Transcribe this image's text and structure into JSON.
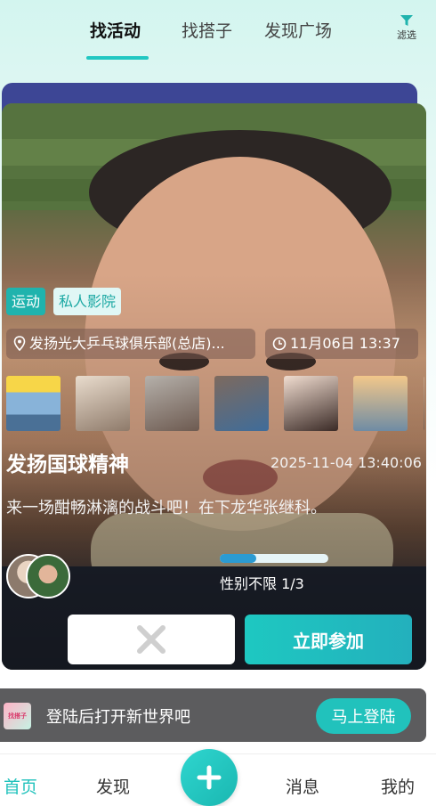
{
  "top_tabs": {
    "tabs": [
      {
        "label": "找活动",
        "active": true
      },
      {
        "label": "找搭子",
        "active": false
      },
      {
        "label": "发现广场",
        "active": false
      }
    ],
    "filter_label": "滤选",
    "filter_icon": "filter-icon"
  },
  "card": {
    "tags": [
      "运动",
      "私人影院"
    ],
    "location": "发扬光大乒乓球俱乐部(总店)...",
    "location_icon": "location-pin-icon",
    "start_time": "11月06日 13:37",
    "time_icon": "clock-icon",
    "title": "发扬国球精神",
    "posted_at": "2025-11-04 13:40:06",
    "description": "来一场酣畅淋漓的战斗吧！在下龙华张继科。",
    "gender_text": "性别不限 1/3",
    "participants_filled": 1,
    "participants_total": 3,
    "join_label": "立即参加",
    "reject_icon": "close-x-icon"
  },
  "login_banner": {
    "logo_text": "找搭子",
    "text": "登陆后打开新世界吧",
    "button_label": "马上登陆"
  },
  "bottom_nav": {
    "items": [
      {
        "label": "首页",
        "active": true
      },
      {
        "label": "发现",
        "active": false
      },
      {
        "label": "消息",
        "active": false
      },
      {
        "label": "我的",
        "active": false
      }
    ],
    "plus_icon": "plus-icon"
  },
  "colors": {
    "accent": "#21c2bc",
    "back_card": "#3d4695",
    "banner": "#5c5c5e"
  }
}
